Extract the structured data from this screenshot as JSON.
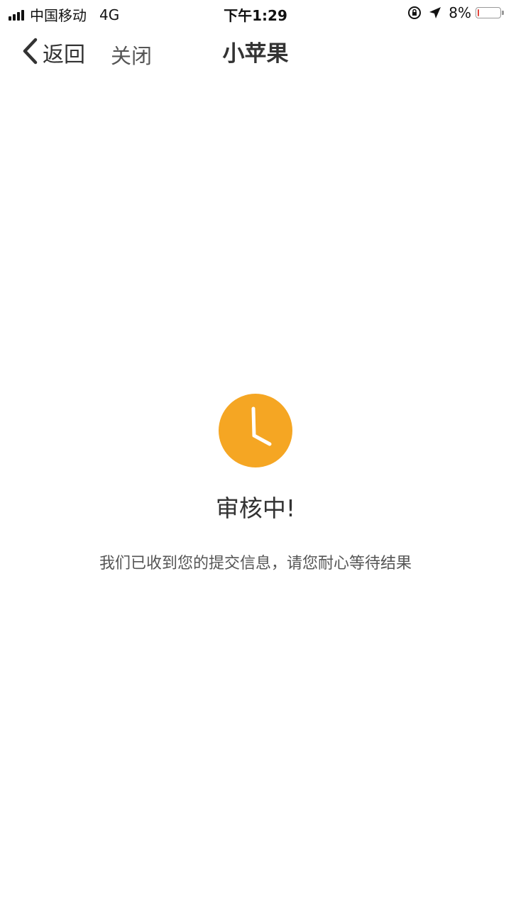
{
  "status_bar": {
    "carrier": "中国移动",
    "network": "4G",
    "time": "下午1:29",
    "battery": "8%",
    "battery_level": 0.08,
    "battery_color": "#e0463d"
  },
  "nav": {
    "back_label": "返回",
    "close_label": "关闭",
    "title": "小苹果"
  },
  "review": {
    "title": "审核中!",
    "description": "我们已收到您的提交信息，请您耐心等待结果",
    "icon": "clock-icon",
    "icon_color": "#f5a623"
  }
}
